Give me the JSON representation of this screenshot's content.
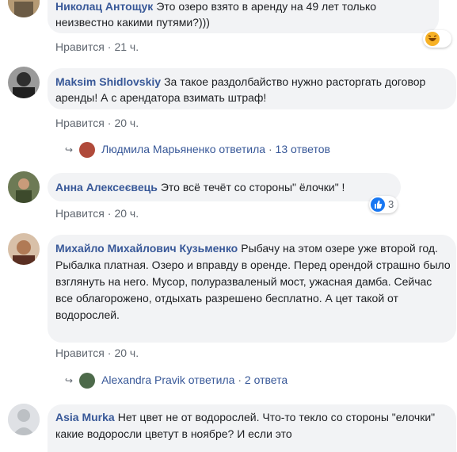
{
  "comments": [
    {
      "author": "Николац Антощук",
      "text": "Это озеро взято в аренду на 49 лет только неизвестно какими путями?)))",
      "like_label": "Нравится",
      "time": "21 ч.",
      "reaction": {
        "icon": "haha-icon",
        "count": ""
      }
    },
    {
      "author": "Maksim Shidlovskiy",
      "text": "За такое раздолбайство нужно расторгать договор аренды! А с арендатора взимать штраф!",
      "like_label": "Нравится",
      "time": "20 ч.",
      "reply": {
        "name": "Людмила Марьяненко",
        "action": "ответила",
        "count": "13 ответов"
      }
    },
    {
      "author": "Анна Алексеєвець",
      "text": "Это всё течёт со стороны\" ёлочки\" !",
      "like_label": "Нравится",
      "time": "20 ч.",
      "reaction": {
        "icon": "like-icon",
        "count": "3"
      }
    },
    {
      "author": "Михайло Михайлович Кузьменко",
      "text": "Рыбачу на этом озере уже второй год. Рыбалка платная. Озеро и вправду в оренде. Перед орендой страшно было взглянуть на него. Мусор, полуразваленый мост, ужасная дамба. Сейчас все облагорожено, отдыхать разрешено бесплатно. А цет такой от водорослей.",
      "like_label": "Нравится",
      "time": "20 ч.",
      "reply": {
        "name": "Alexandra Pravik",
        "action": "ответила",
        "count": "2 ответа"
      }
    },
    {
      "author": "Asia Murka",
      "text": "Нет цвет не от водорослей. Что-то текло со стороны \"елочки\" какие водоросли цветут в ноябре? И если это",
      "like_label": "",
      "time": ""
    }
  ],
  "separator": "·",
  "colors": {
    "link": "#385898",
    "meta": "#606770",
    "bubble": "#f2f3f5",
    "like_blue": "#1877f2"
  }
}
